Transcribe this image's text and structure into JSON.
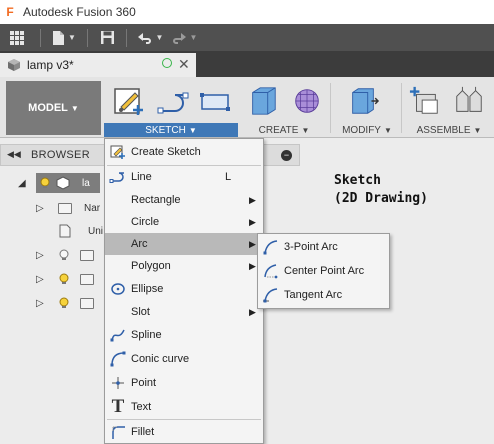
{
  "app": {
    "logo_letter": "F",
    "title": "Autodesk Fusion 360"
  },
  "qat": {
    "icons": [
      "grid-icon",
      "file-icon",
      "save-icon",
      "undo-icon",
      "redo-icon"
    ]
  },
  "tab": {
    "label": "lamp v3*",
    "close": "✕"
  },
  "ribbon": {
    "workspace": "MODEL",
    "groups": {
      "sketch": "SKETCH",
      "create": "CREATE",
      "modify": "MODIFY",
      "assemble": "ASSEMBLE"
    }
  },
  "browser": {
    "title": "BROWSER",
    "root_label": "la",
    "rows": [
      "Nar",
      "Uni"
    ]
  },
  "annotation": {
    "line1": "Sketch",
    "line2": "(2D Drawing)"
  },
  "menu": {
    "items": [
      {
        "label": "Create Sketch",
        "icon": "create-sketch-icon"
      },
      {
        "label": "Line",
        "shortcut": "L",
        "icon": "line-icon"
      },
      {
        "label": "Rectangle",
        "icon": "",
        "submenu": true
      },
      {
        "label": "Circle",
        "icon": "",
        "submenu": true
      },
      {
        "label": "Arc",
        "icon": "",
        "submenu": true
      },
      {
        "label": "Polygon",
        "icon": "",
        "submenu": true
      },
      {
        "label": "Ellipse",
        "icon": "ellipse-icon"
      },
      {
        "label": "Slot",
        "icon": "",
        "submenu": true
      },
      {
        "label": "Spline",
        "icon": "spline-icon"
      },
      {
        "label": "Conic curve",
        "icon": "conic-curve-icon"
      },
      {
        "label": "Point",
        "icon": "point-icon"
      },
      {
        "label": "Text",
        "icon": "text-icon"
      },
      {
        "label": "Fillet",
        "icon": "fillet-icon"
      }
    ]
  },
  "submenu": {
    "items": [
      {
        "label": "3-Point Arc",
        "icon": "three-point-arc-icon"
      },
      {
        "label": "Center Point Arc",
        "icon": "center-point-arc-icon"
      },
      {
        "label": "Tangent Arc",
        "icon": "tangent-arc-icon"
      }
    ]
  },
  "colors": {
    "accent": "#3f78b7",
    "brand": "#f26b22",
    "highlight": "#b9b9b9"
  }
}
